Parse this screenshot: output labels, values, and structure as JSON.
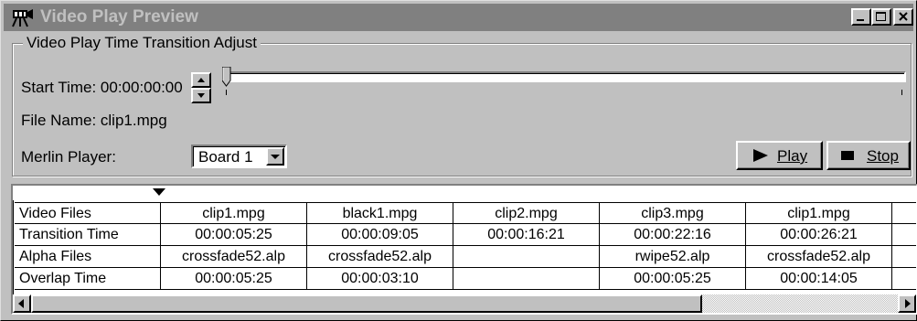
{
  "window": {
    "title": "Video Play Preview",
    "icon": "film-camera-icon",
    "controls": [
      "minimize-icon",
      "maximize-icon",
      "close-icon"
    ]
  },
  "group": {
    "title": "Video Play Time Transition Adjust"
  },
  "start_time": {
    "label": "Start Time: 00:00:00:00",
    "slider_position": 0
  },
  "file_name": {
    "label": "File Name: clip1.mpg"
  },
  "merlin_player": {
    "label": "Merlin Player:",
    "selected": "Board 1"
  },
  "buttons": {
    "play": "Play",
    "stop": "Stop"
  },
  "grid": {
    "row_headers": [
      "Video Files",
      "Transition Time",
      "Alpha Files",
      "Overlap Time"
    ],
    "columns": [
      [
        "clip1.mpg",
        "00:00:05:25",
        "crossfade52.alp",
        "00:00:05:25"
      ],
      [
        "black1.mpg",
        "00:00:09:05",
        "crossfade52.alp",
        "00:00:03:10"
      ],
      [
        "clip2.mpg",
        "00:00:16:21",
        "",
        ""
      ],
      [
        "clip3.mpg",
        "00:00:22:16",
        "rwipe52.alp",
        "00:00:05:25"
      ],
      [
        "clip1.mpg",
        "00:00:26:21",
        "crossfade52.alp",
        "00:00:14:05"
      ]
    ]
  },
  "colors": {
    "face": "#c0c0c0",
    "inactive_title": "#808080"
  }
}
